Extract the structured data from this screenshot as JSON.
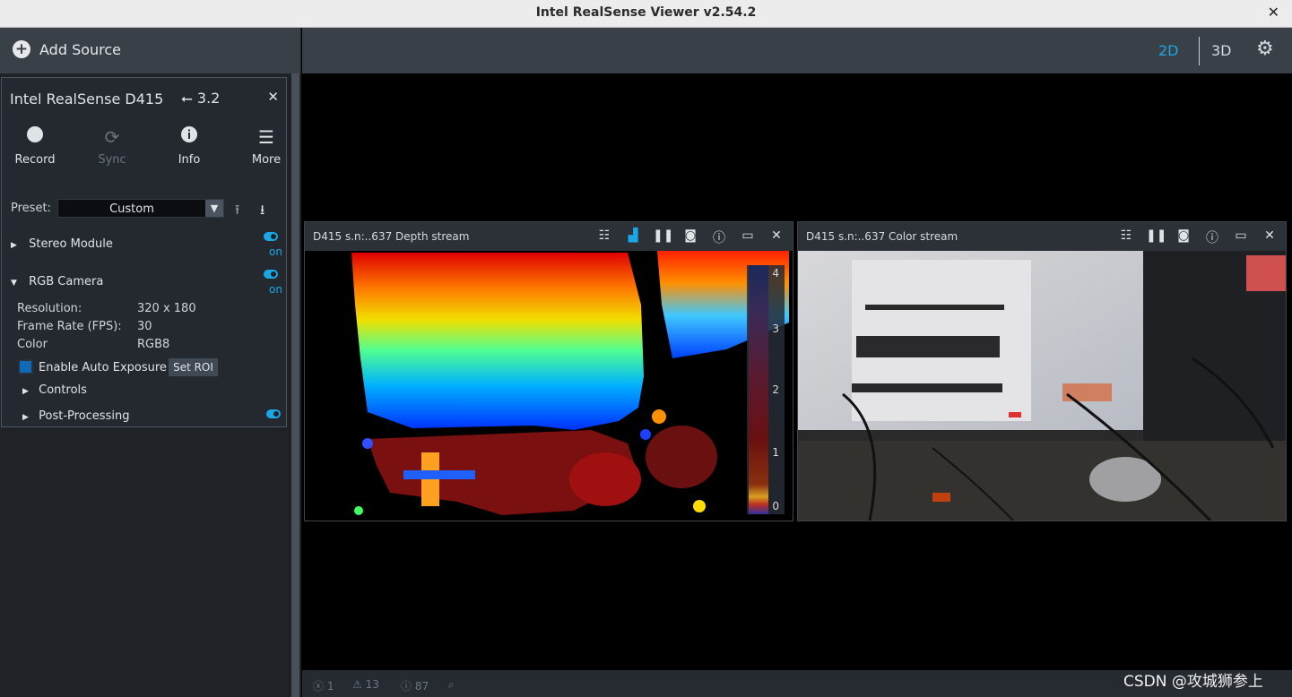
{
  "window": {
    "title": "Intel RealSense Viewer v2.54.2",
    "close_glyph": "✕"
  },
  "toolbar": {
    "add_source": "Add Source",
    "view_2d": "2D",
    "view_3d": "3D"
  },
  "device": {
    "name": "Intel RealSense D415",
    "usb_version": "3.2",
    "actions": [
      {
        "label": "Record",
        "icon": "record-icon",
        "enabled": true
      },
      {
        "label": "Sync",
        "icon": "sync-icon",
        "enabled": false
      },
      {
        "label": "Info",
        "icon": "info-icon",
        "enabled": true
      },
      {
        "label": "More",
        "icon": "menu-icon",
        "enabled": true
      }
    ],
    "preset_label": "Preset:",
    "preset_value": "Custom",
    "stereo_module": {
      "label": "Stereo Module",
      "state": "on"
    },
    "rgb_camera": {
      "label": "RGB Camera",
      "state": "on",
      "resolution_label": "Resolution:",
      "resolution_value": "320 x 180",
      "fps_label": "Frame Rate (FPS):",
      "fps_value": "30",
      "color_label": "Color",
      "color_value": "RGB8",
      "auto_exposure_label": "Enable Auto Exposure",
      "set_roi": "Set ROI",
      "controls": "Controls",
      "post_processing": "Post-Processing"
    }
  },
  "streams": {
    "depth": {
      "title": "D415 s.n:..637 Depth stream",
      "colorbar_ticks": [
        "4",
        "3",
        "2",
        "1",
        "0"
      ]
    },
    "color": {
      "title": "D415 s.n:..637 Color stream"
    }
  },
  "status": {
    "errors": "1",
    "warnings": "13",
    "infos": "87"
  },
  "watermark": "CSDN @攻城狮参上",
  "colors": {
    "accent": "#1aa7e6",
    "panel": "#3a4048"
  }
}
